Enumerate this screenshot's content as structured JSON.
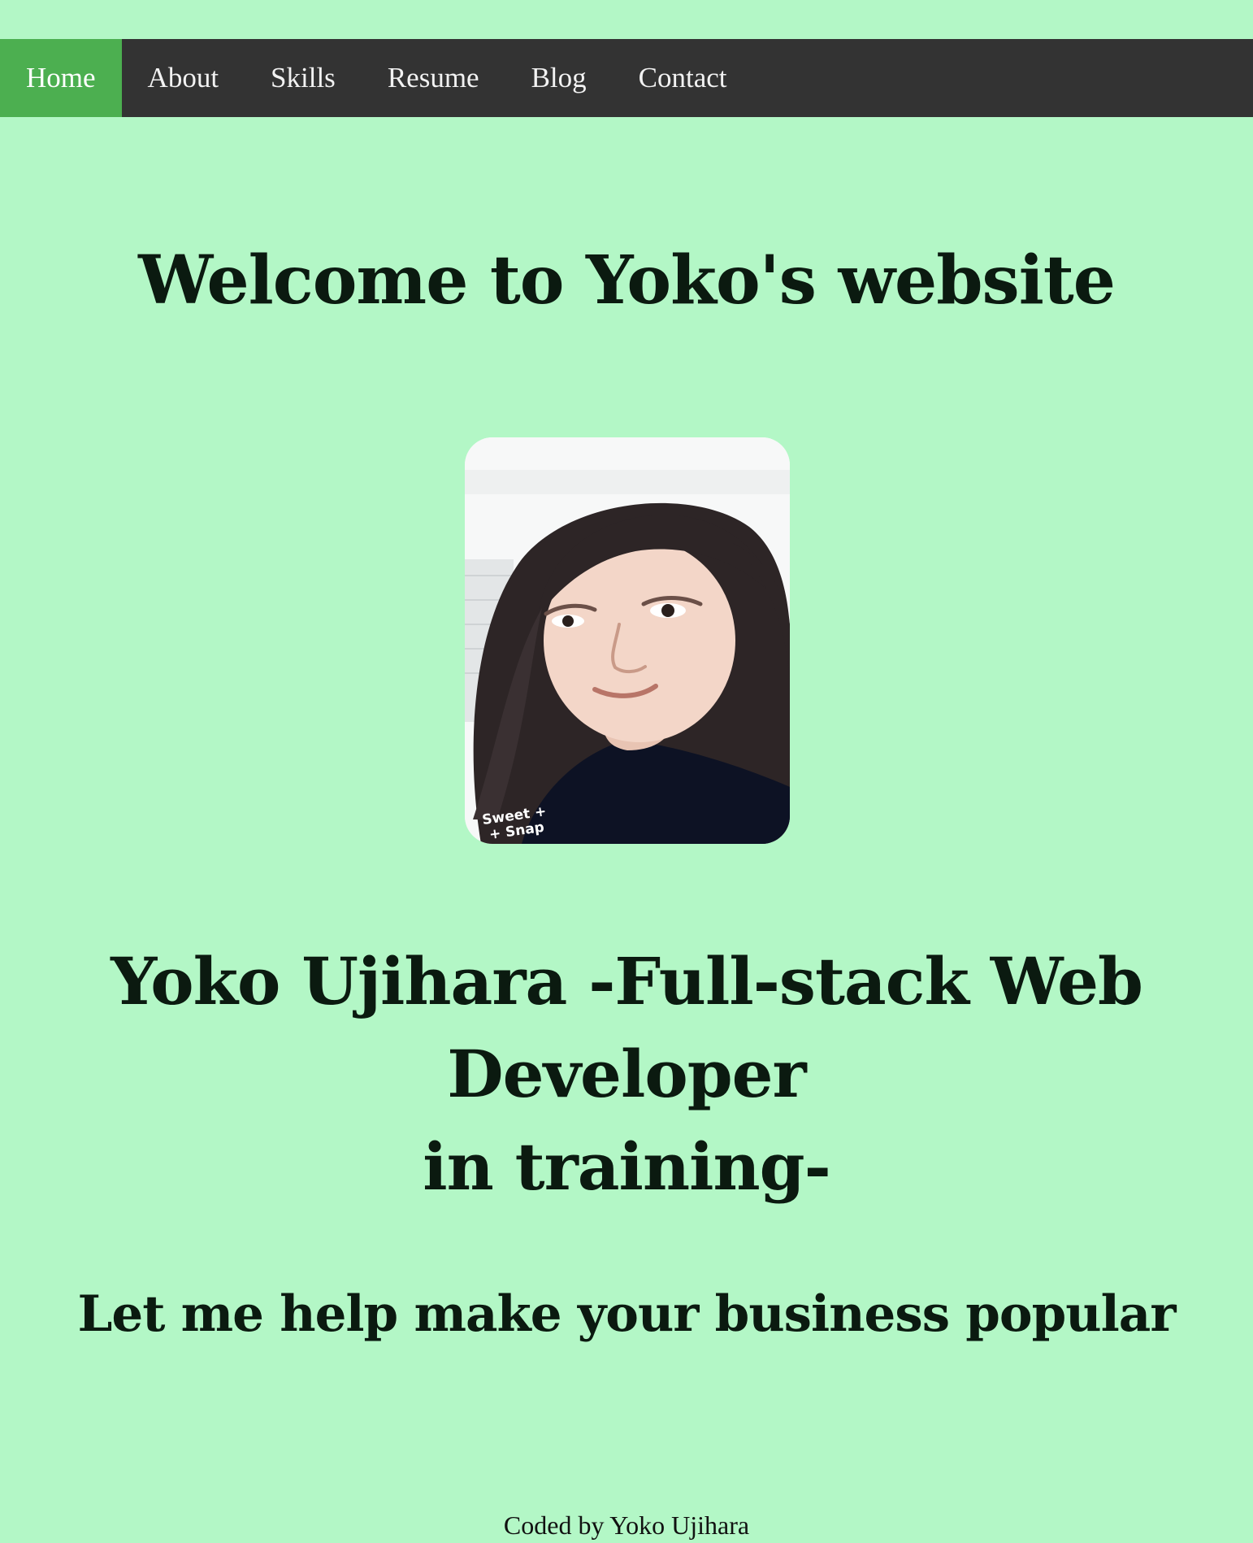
{
  "nav": {
    "items": [
      {
        "label": "Home",
        "active": true
      },
      {
        "label": "About",
        "active": false
      },
      {
        "label": "Skills",
        "active": false
      },
      {
        "label": "Resume",
        "active": false
      },
      {
        "label": "Blog",
        "active": false
      },
      {
        "label": "Contact",
        "active": false
      }
    ]
  },
  "hero": {
    "welcome": "Welcome to Yoko's website",
    "photo_watermark_line1": "Sweet +",
    "photo_watermark_line2": "+ Snap",
    "subtitle_line1": "Yoko Ujihara -Full-stack Web Developer",
    "subtitle_line2": "in training-",
    "tagline": "Let me help make your business popular"
  },
  "footer": {
    "credit": "Coded by Yoko Ujihara"
  },
  "colors": {
    "page_background": "#b3f7c6",
    "nav_background": "#333333",
    "nav_active": "#4caf50",
    "nav_text": "#f2f2f2"
  }
}
